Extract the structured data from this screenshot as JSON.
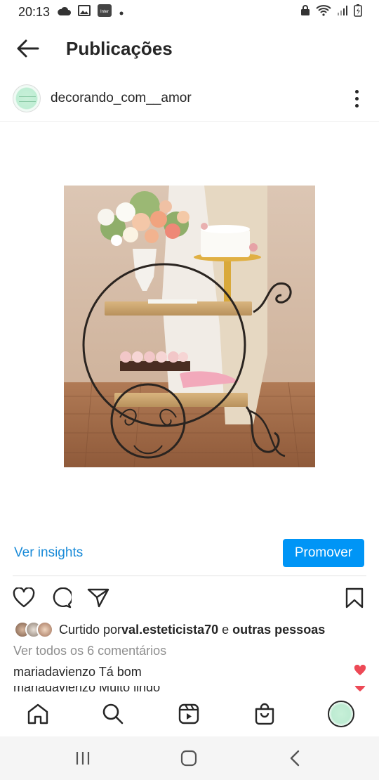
{
  "status_bar": {
    "time": "20:13",
    "left_icons": [
      "cloud-icon",
      "image-icon",
      "inter-app-icon",
      "dot-icon"
    ],
    "inter_label": "Inter",
    "right_icons": [
      "lock-icon",
      "wifi-icon",
      "signal-icon",
      "battery-icon"
    ]
  },
  "header": {
    "title": "Publicações",
    "back_icon": "arrow-left-icon"
  },
  "post": {
    "username": "decorando_com__amor",
    "image_alt": "wedding cart decor with flowers, cake and cupcakes"
  },
  "insights": {
    "link_label": "Ver insights",
    "promote_label": "Promover"
  },
  "actions": {
    "icons": [
      "heart-icon",
      "comment-icon",
      "share-icon",
      "bookmark-icon"
    ]
  },
  "likes": {
    "prefix": "Curtido por ",
    "user": "val.esteticista70",
    "middle": " e ",
    "others": "outras pessoas"
  },
  "comments": {
    "view_all": "Ver todos os 6 comentários",
    "items": [
      {
        "user": "mariadavienzo",
        "text": "Tá bom"
      },
      {
        "user": "mariadavienzo",
        "text": "Muito lindo"
      }
    ]
  },
  "bottom_nav": [
    "home-icon",
    "search-icon",
    "reels-icon",
    "shop-icon",
    "profile-avatar"
  ],
  "system_nav": [
    "recent-apps-icon",
    "home-button-icon",
    "back-button-icon"
  ],
  "colors": {
    "accent": "#0095f6",
    "link": "#1a8bd8",
    "like_red": "#ed4956",
    "text": "#262626",
    "muted": "#8e8e8e"
  }
}
